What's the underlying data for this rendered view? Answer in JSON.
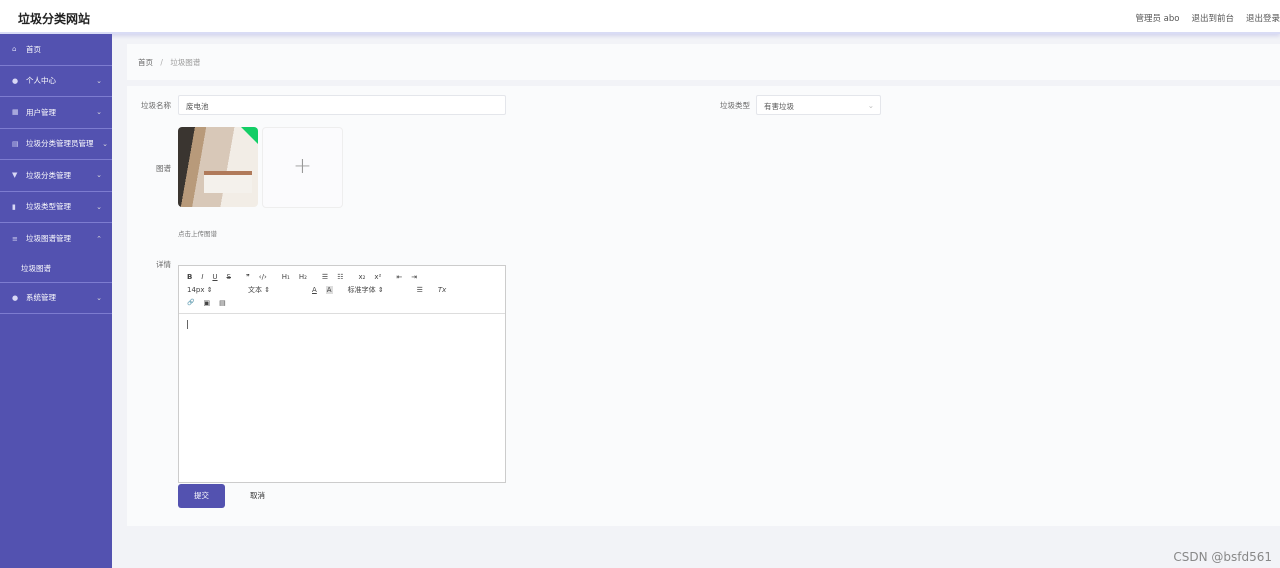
{
  "header": {
    "title": "垃圾分类网站",
    "user": "管理员 abo",
    "front": "退出到前台",
    "logout": "退出登录"
  },
  "sidebar": {
    "items": [
      {
        "label": "首页",
        "icon": "⌂"
      },
      {
        "label": "个人中心",
        "icon": "●"
      },
      {
        "label": "用户管理",
        "icon": "▦"
      },
      {
        "label": "垃圾分类管理员管理",
        "icon": "▤"
      },
      {
        "label": "垃圾分类管理",
        "icon": "▼"
      },
      {
        "label": "垃圾类型管理",
        "icon": "▮"
      },
      {
        "label": "垃圾图谱管理",
        "icon": "≡"
      },
      {
        "label": "系统管理",
        "icon": "●"
      }
    ],
    "sub": "垃圾图谱"
  },
  "breadcrumb": {
    "home": "首页",
    "sep": "/",
    "current": "垃圾图谱"
  },
  "form": {
    "name_label": "垃圾名称",
    "name_value": "废电池",
    "type_label": "垃圾类型",
    "type_value": "有害垃圾",
    "image_label": "图谱",
    "upload_hint": "点击上传图谱",
    "detail_label": "详情",
    "submit": "提交",
    "cancel": "取消"
  },
  "editor": {
    "row1": [
      "B",
      "I",
      "U",
      "S",
      "❞",
      "‹/›",
      "H₁",
      "H₂",
      "☰",
      "☷",
      "x₂",
      "x²",
      "⇤",
      "⇥"
    ],
    "size": "14px",
    "header": "文本",
    "font": "标准字体",
    "row3": [
      "🔗",
      "▣",
      "▤"
    ]
  },
  "watermark": "CSDN @bsfd561"
}
